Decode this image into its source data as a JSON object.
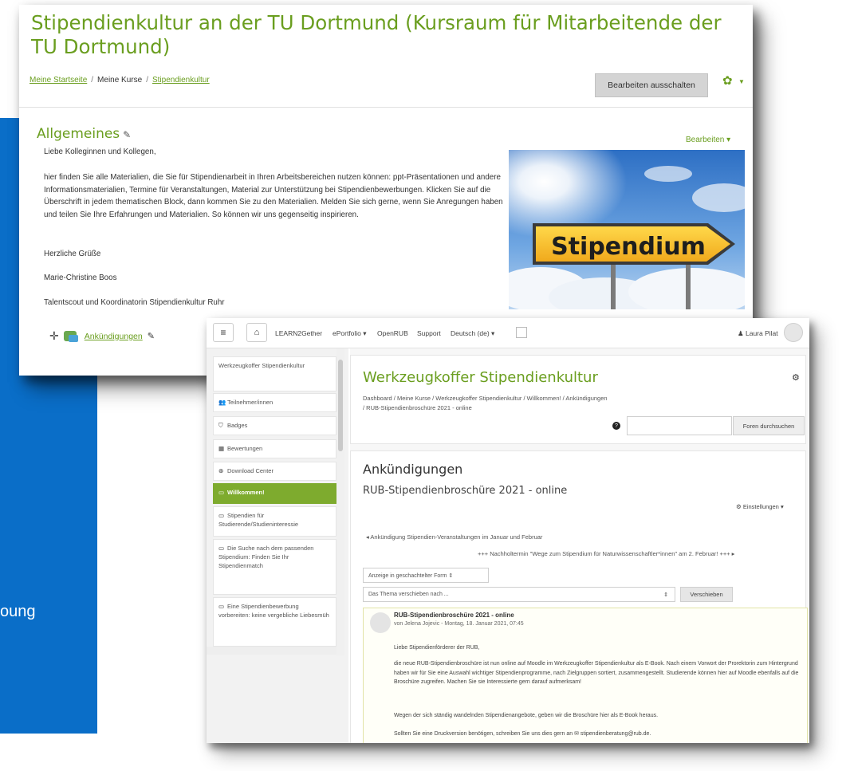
{
  "slide": {
    "fragment_text": "oung"
  },
  "course_page": {
    "title": "Stipendienkultur an der TU Dortmund (Kursraum für Mitarbeitende der TU Dortmund)",
    "breadcrumb": [
      "Meine Startseite",
      "Meine Kurse",
      "Stipendienkultur"
    ],
    "edit_button": "Bearbeiten ausschalten",
    "section_title": "Allgemeines",
    "section_edit": "Bearbeiten",
    "paragraphs": [
      "Liebe Kolleginnen und Kollegen,",
      "hier finden Sie alle Materialien, die Sie für Stipendienarbeit in Ihren Arbeitsbereichen nutzen können: ppt-Präsentationen und andere Informationsmaterialien, Termine für Veranstaltungen, Material zur Unterstützung bei Stipendienbewerbungen. Klicken Sie auf die Überschrift in jedem thematischen Block, dann kommen Sie zu den Materialien. Melden Sie sich gerne, wenn Sie Anregungen haben und teilen Sie Ihre Erfahrungen und Materialien. So können wir uns gegenseitig inspirieren.",
      "Herzliche Grüße",
      "Marie-Christine Boos",
      "Talentscout und Koordinatorin Stipendienkultur Ruhr"
    ],
    "image_sign_text": "Stipendium",
    "activity_label": "Ankündigungen"
  },
  "forum_page": {
    "navbar": {
      "items": [
        "LEARN2Gether",
        "ePortfolio ▾",
        "OpenRUB",
        "Support",
        "Deutsch (de) ▾"
      ],
      "user": "Laura Pilat"
    },
    "sidebar": [
      {
        "label": "Werkzeugkoffer Stipendienkultur",
        "icon": ""
      },
      {
        "label": "Teilnehmer/innen",
        "icon": "users-icon"
      },
      {
        "label": "Badges",
        "icon": "shield-icon"
      },
      {
        "label": "Bewertungen",
        "icon": "table-icon"
      },
      {
        "label": "Download Center",
        "icon": "download-icon"
      },
      {
        "label": "Willkommen!",
        "icon": "folder-icon",
        "active": true
      },
      {
        "label": "Stipendien für Studierende/Studieninteressie",
        "icon": "folder-icon"
      },
      {
        "label": "Die Suche nach dem passenden Stipendium: Finden Sie Ihr Stipendienmatch",
        "icon": "folder-icon"
      },
      {
        "label": "Eine Stipendienbewerbung vorbereiten: keine vergebliche Liebesmüh",
        "icon": "folder-icon"
      }
    ],
    "course_title": "Werkzeugkoffer Stipendienkultur",
    "breadcrumb_line1": "Dashboard / Meine Kurse / Werkzeugkoffer Stipendienkultur / Willkommen! / Ankündigungen",
    "breadcrumb_line2": "/ RUB-Stipendienbroschüre 2021 - online",
    "search_button": "Foren durchsuchen",
    "forum_heading": "Ankündigungen",
    "discussion_title": "RUB-Stipendienbroschüre 2021 - online",
    "settings_label": "Einstellungen",
    "prev_link": "◂ Ankündigung Stipendien-Veranstaltungen im Januar und Februar",
    "next_link": "+++ Nachholtermin \"Wege zum Stipendium für Naturwissenschaftler*innen\" am 2. Februar! +++ ▸",
    "display_mode": "Anzeige in geschachtelter Form",
    "move_select": "Das Thema verschieben nach ...",
    "move_button": "Verschieben",
    "post": {
      "title": "RUB-Stipendienbroschüre 2021 - online",
      "byline": "von Jelena Jojevic - Montag, 18. Januar 2021, 07:45",
      "paragraphs": [
        "Liebe Stipendienförderer der RUB,",
        "die neue RUB-Stipendienbroschüre ist nun online auf Moodle im Werkzeugkoffer Stipendienkultur als E-Book. Nach einem Vorwort der Prorektorin zum Hintergrund haben wir für Sie eine Auswahl wichtiger Stipendienprogramme, nach Zielgruppen sortiert, zusammengestellt. Studierende können hier auf Moodle ebenfalls auf die Broschüre zugreifen. Machen Sie sie Interessierte gern darauf aufmerksam!",
        "Wegen der sich ständig wandelnden Stipendienangebote, geben wir die Broschüre hier als E-Book heraus.",
        "Sollten Sie eine Druckversion benötigen, schreiben Sie uns dies gern an ✉ stipendienberatung@rub.de."
      ]
    }
  },
  "colors": {
    "moodle_green": "#6a9e1f",
    "slide_blue": "#0a6ec8",
    "active_green": "#7eab2e"
  }
}
